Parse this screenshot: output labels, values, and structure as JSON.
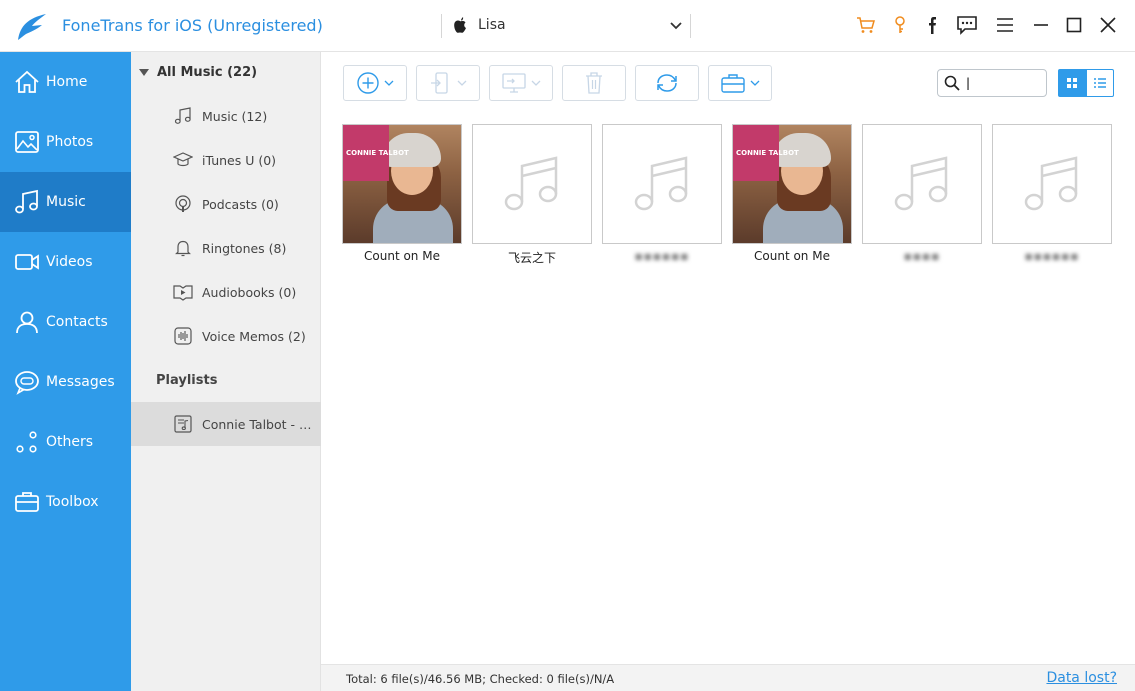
{
  "app": {
    "title": "FoneTrans for iOS (Unregistered)",
    "device_name": "Lisa",
    "accent_color": "#2f9be9",
    "title_color": "#2b8fe0"
  },
  "titlebar_icons": [
    "cart-icon",
    "key-icon",
    "facebook-icon",
    "feedback-icon",
    "menu-icon",
    "minimize-icon",
    "maximize-icon",
    "close-icon"
  ],
  "nav": {
    "items": [
      {
        "label": "Home",
        "icon": "home-icon"
      },
      {
        "label": "Photos",
        "icon": "photo-icon"
      },
      {
        "label": "Music",
        "icon": "music-note-icon",
        "active": true
      },
      {
        "label": "Videos",
        "icon": "video-camera-icon"
      },
      {
        "label": "Contacts",
        "icon": "person-icon"
      },
      {
        "label": "Messages",
        "icon": "chat-bubble-icon"
      },
      {
        "label": "Others",
        "icon": "dots-icon"
      },
      {
        "label": "Toolbox",
        "icon": "toolbox-icon"
      }
    ]
  },
  "categories": {
    "header": "All Music (22)",
    "items": [
      {
        "label": "Music (12)",
        "icon": "music-note-icon"
      },
      {
        "label": "iTunes U (0)",
        "icon": "graduation-cap-icon"
      },
      {
        "label": "Podcasts (0)",
        "icon": "podcast-icon"
      },
      {
        "label": "Ringtones (8)",
        "icon": "bell-icon"
      },
      {
        "label": "Audiobooks (0)",
        "icon": "audiobook-icon"
      },
      {
        "label": "Voice Memos (2)",
        "icon": "waveform-icon"
      }
    ],
    "playlists_header": "Playlists",
    "playlists": [
      {
        "label": "Connie Talbot - Bea...",
        "icon": "playlist-icon",
        "selected": true
      }
    ]
  },
  "toolbar": {
    "buttons": [
      "add-button",
      "export-to-device-button",
      "export-to-pc-button",
      "delete-button",
      "refresh-button",
      "toolbox-button"
    ],
    "search_value": "|"
  },
  "tracks": [
    {
      "title": "Count on Me",
      "has_art": true,
      "blurred": false
    },
    {
      "title": "飞云之下",
      "has_art": false,
      "blurred": false
    },
    {
      "title": "▪▪▪▪▪▪",
      "has_art": false,
      "blurred": true
    },
    {
      "title": "Count on Me",
      "has_art": true,
      "blurred": false
    },
    {
      "title": "▪▪▪▪",
      "has_art": false,
      "blurred": true
    },
    {
      "title": "▪▪▪▪▪▪",
      "has_art": false,
      "blurred": true
    }
  ],
  "album_art_text": "CONNIE TALBOT",
  "status": {
    "text": "Total: 6 file(s)/46.56 MB; Checked: 0 file(s)/N/A",
    "link": "Data lost?"
  }
}
